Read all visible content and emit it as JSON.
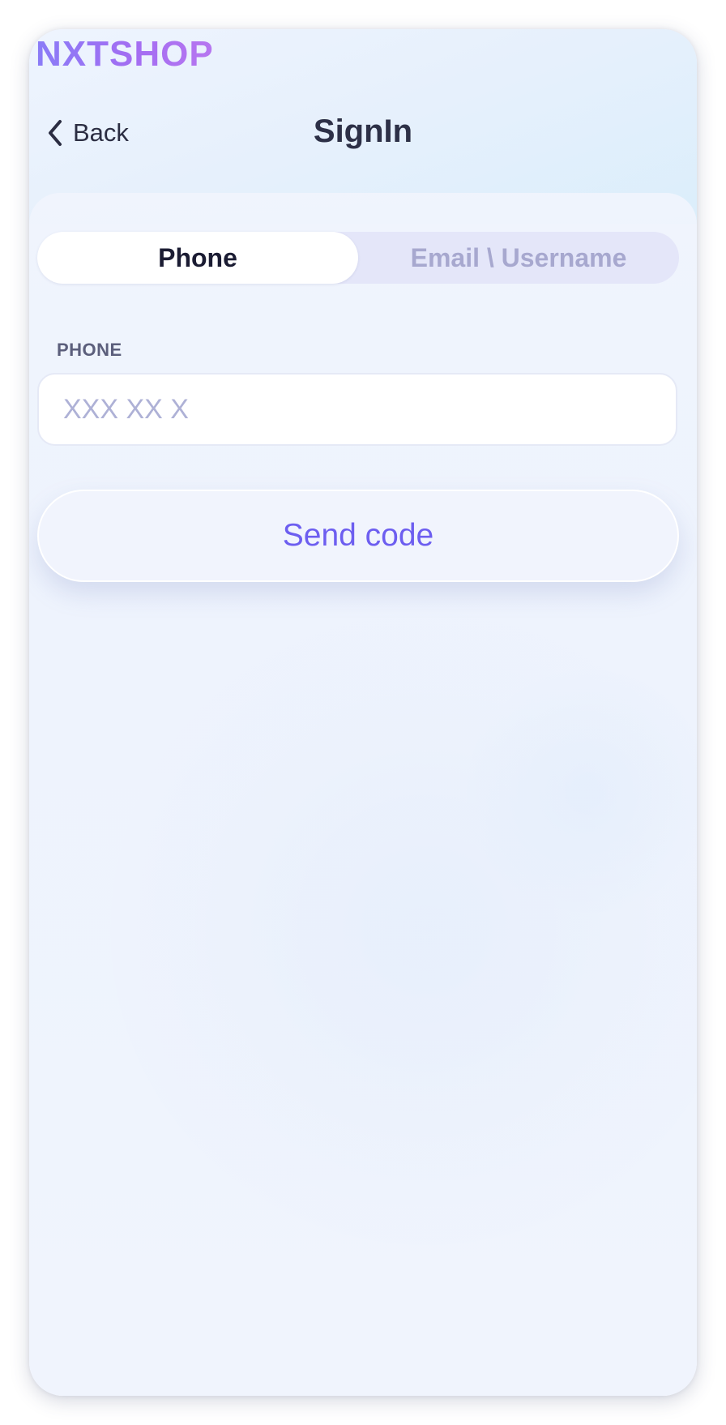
{
  "brand": {
    "logo_text": "NXTSHOP"
  },
  "nav": {
    "back_label": "Back",
    "title": "SignIn"
  },
  "tabs": {
    "items": [
      {
        "label": "Phone",
        "active": true
      },
      {
        "label": "Email \\ Username",
        "active": false
      }
    ]
  },
  "form": {
    "phone_label": "PHONE",
    "phone_value": "",
    "phone_placeholder": "XXX XX X",
    "submit_label": "Send code"
  },
  "colors": {
    "accent": "#6d5ef0",
    "logo_gradient_start": "#8a7cf7",
    "logo_gradient_end": "#b777f0",
    "title_text": "#2d3047",
    "inactive_tab_text": "#a7a8cf"
  },
  "icons": {
    "back": "chevron-left-icon"
  }
}
